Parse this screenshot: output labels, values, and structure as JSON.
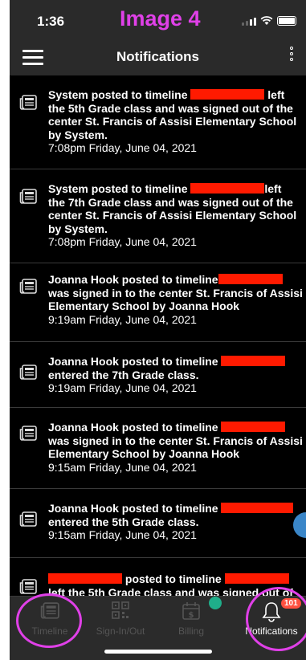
{
  "status_bar": {
    "time": "1:36",
    "overlay_label": "Image 4"
  },
  "header": {
    "title": "Notifications"
  },
  "notifications": [
    {
      "line1_prefix": "System  posted to timeline",
      "line1_suffix": "left",
      "rest": "the 5th Grade class and was signed out of the center St. Francis of Assisi Elementary School by System.",
      "time": "7:08pm Friday, June 04, 2021"
    },
    {
      "line1_prefix": "System  posted to timeline",
      "line1_suffix": "left",
      "rest": "the 7th Grade class and was signed out of the center St. Francis of Assisi Elementary School by System.",
      "time": "7:08pm Friday, June 04, 2021"
    },
    {
      "line1_prefix": "Joanna Hook posted to timeline",
      "line1_suffix": "",
      "rest": "was signed in to the center St. Francis of Assisi Elementary School by Joanna Hook",
      "time": "9:19am Friday, June 04, 2021"
    },
    {
      "line1_prefix": "Joanna Hook posted to timeline",
      "line1_suffix": "",
      "rest": "entered the 7th Grade class.",
      "time": "9:19am Friday, June 04, 2021"
    },
    {
      "line1_prefix": "Joanna Hook posted to timeline",
      "line1_suffix": "",
      "rest": "was signed in to the center St. Francis of Assisi Elementary School by Joanna Hook",
      "time": "9:15am Friday, June 04, 2021"
    },
    {
      "line1_prefix": "Joanna Hook posted to timeline",
      "line1_suffix": "",
      "rest": "entered the 5th Grade class.",
      "time": "9:15am Friday, June 04, 2021"
    },
    {
      "line1_prefix": "posted to timeline",
      "line1_suffix": "",
      "rest": "left the 5th Grade class and was signed out of",
      "time": ""
    }
  ],
  "tabs": [
    {
      "label": "Timeline",
      "icon": "newspaper-icon"
    },
    {
      "label": "Sign-In/Out",
      "icon": "qr-code-icon"
    },
    {
      "label": "Billing",
      "icon": "invoice-calendar-icon"
    },
    {
      "label": "Notifications",
      "icon": "bell-icon",
      "badge": "101"
    }
  ],
  "colors": {
    "background": "#000000",
    "header": "#2a2a2a",
    "annotation": "#e040e8",
    "redaction": "#ff1a00",
    "billing_dot": "#1fae8a"
  }
}
